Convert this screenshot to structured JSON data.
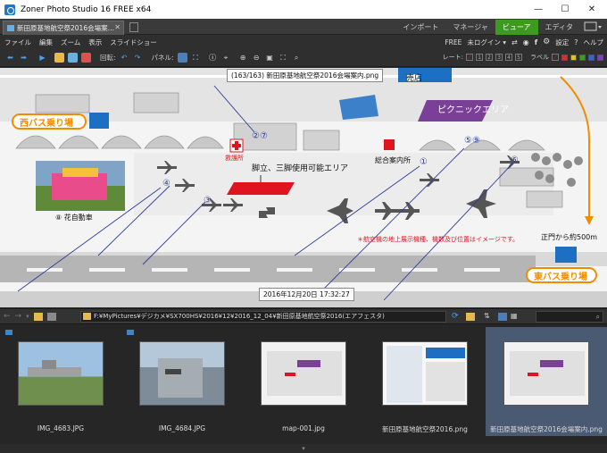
{
  "window": {
    "title": "Zoner Photo Studio 16 FREE x64",
    "minimize": "—",
    "maximize": "☐",
    "close": "✕"
  },
  "tabs": {
    "document": "新田原基地航空祭2016会場案…",
    "close": "✕"
  },
  "modules": [
    "インポート",
    "マネージャ",
    "ビューア",
    "エディタ"
  ],
  "menu": {
    "items": [
      "ファイル",
      "編集",
      "ズーム",
      "表示",
      "スライドショー"
    ],
    "free": "FREE",
    "login": "未ログイン ▾",
    "settings": "設定",
    "help": "ヘルプ"
  },
  "toolbar": {
    "rotate": "回転:",
    "panel": "パネル:",
    "rating": "レート:",
    "stars": [
      "1",
      "2",
      "3",
      "4",
      "5"
    ],
    "label": "ラベル"
  },
  "viewer": {
    "file_label": "(163/163) 新田原基地航空祭2016会場案内.png",
    "date_label": "2016年12月20日  17:32:27",
    "map": {
      "west_bus": "西バス乗り場",
      "east_bus": "東バス乗り場",
      "shop": "売店",
      "picnic": "ピクニックエリア",
      "rescue": "救護所",
      "info": "総合案内所",
      "tripod": "脚立、三脚使用可能エリア",
      "float": "花自動車",
      "float_num": "⑧",
      "notice": "＊航空機の地上展示機種、機数及び位置はイメージです。",
      "gate": "正門から約500m",
      "markers": [
        "①",
        "②⑦",
        "③",
        "④",
        "⑤⑨",
        "⑥"
      ]
    }
  },
  "navbar": {
    "path": "F:¥MyPictures¥デジカメ¥SX700HS¥2016¥12¥2016_12_04¥新田原基地航空祭2016(エアフェスタ)"
  },
  "filmstrip": [
    {
      "name": "IMG_4683.JPG",
      "selected": false
    },
    {
      "name": "IMG_4684.JPG",
      "selected": false
    },
    {
      "name": "map-001.jpg",
      "selected": false
    },
    {
      "name": "新田原基地航空祭2016.png",
      "selected": false
    },
    {
      "name": "新田原基地航空祭2016会場案内.png",
      "selected": true
    }
  ],
  "colors": {
    "accent_green": "#3c9a1f",
    "map_orange": "#f08c00",
    "map_blue": "#1d6fc4",
    "map_purple": "#7a3f96",
    "map_red": "#e0141e",
    "selected_thumb": "#4a5a73"
  }
}
